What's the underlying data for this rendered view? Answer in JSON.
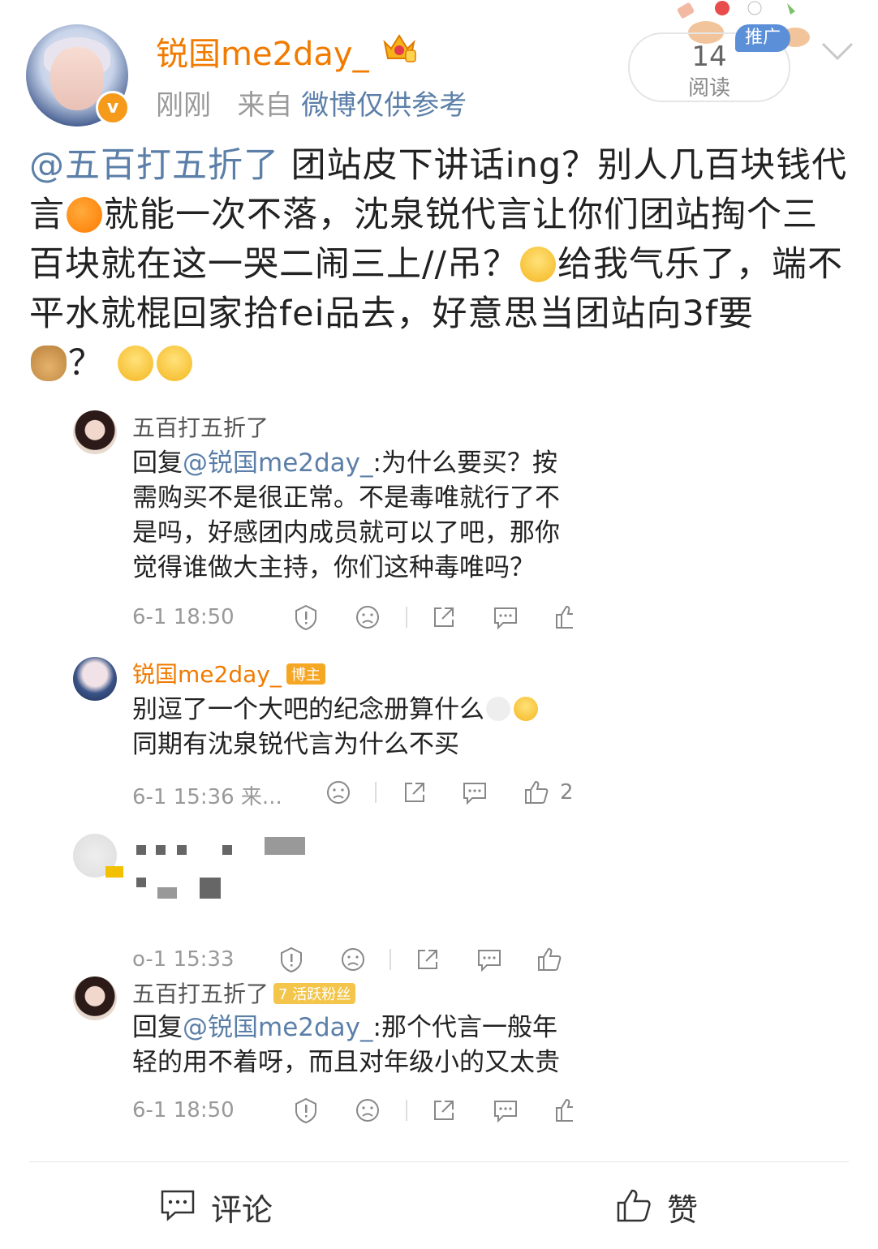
{
  "post": {
    "username": "锐国me2day_",
    "time": "刚刚",
    "source_prefix": "来自",
    "source": "微博仅供参考",
    "read_count": "14",
    "read_label": "阅读",
    "ad_badge": "推广",
    "text": {
      "mention": "@五百打五折了",
      "part1": " 团站皮下讲话ing？别人几百块钱代言",
      "part2": "就能一次不落，沈泉锐代言让你们团站掏个三百块就在这一哭二闹三上//吊？",
      "part3": "给我气乐了，端不平水就棍回家拾fei品去，好意思当团站向3f要",
      "part4": "？ "
    }
  },
  "comments": [
    {
      "name": "五百打五折了",
      "body_prefix": "回复",
      "mention": "@锐国me2day_",
      "body": ":为什么要买？按需购买不是很正常。不是毒唯就行了不是吗，好感团内成员就可以了吧，那你觉得谁做大主持，你们这种毒唯吗？",
      "time": "6-1 18:50"
    },
    {
      "name": "锐国me2day_",
      "tag": "博主",
      "body": "别逗了一个大吧的纪念册算什么",
      "body2": "同期有沈泉锐代言为什么不买",
      "time": "6-1 15:36 来...",
      "likes": "2"
    },
    {
      "time": "o-1 15:33"
    },
    {
      "name": "五百打五折了",
      "tag": "7 活跃粉丝",
      "body_prefix": "回复",
      "mention": "@锐国me2day_",
      "body": ":那个代言一般年轻的用不着呀，而且对年级小的又太贵",
      "time": "6-1 18:50"
    }
  ],
  "bottom_bar": {
    "comment_label": "评论",
    "like_label": "赞"
  }
}
